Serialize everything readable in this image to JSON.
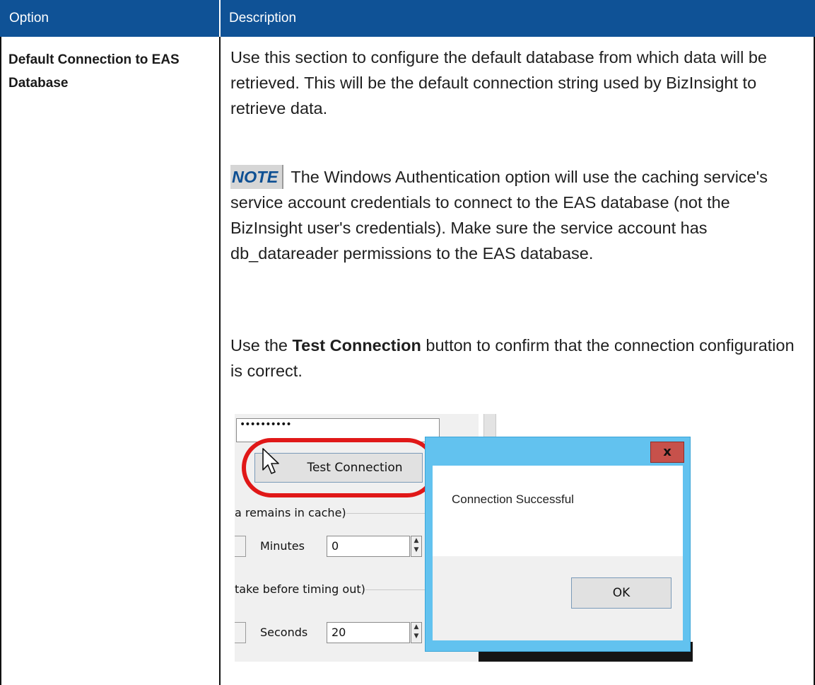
{
  "table": {
    "headers": {
      "option": "Option",
      "description": "Description"
    },
    "row": {
      "option": "Default Connection to EAS Database",
      "paragraph1": "Use this section to configure the default database from which data will be retrieved. This will be the default connection string used by BizInsight to retrieve data.",
      "note_label": "NOTE",
      "note_text": " The Windows Authentication option will use the caching service's service account credentials to connect to the EAS database (not the BizInsight user's credentials). Make sure the service account has db_datareader permissions to the EAS database.",
      "paragraph3_before": "Use the ",
      "paragraph3_bold": "Test Connection",
      "paragraph3_after": " button to confirm that the connection configuration is correct."
    }
  },
  "screenshot": {
    "password_value": "••••••••••",
    "test_button_label": "Test Connection",
    "group1_label": "a remains in cache)",
    "minutes_label": "Minutes",
    "minutes_value": "0",
    "group2_label": "take before timing out)",
    "seconds_label": "Seconds",
    "seconds_value": "20",
    "dialog": {
      "close_label": "x",
      "message": "Connection Successful",
      "ok_label": "OK"
    },
    "colors": {
      "highlight": "#e01818",
      "dialog_frame": "#62c2ef",
      "header_bg": "#0f5296"
    }
  }
}
